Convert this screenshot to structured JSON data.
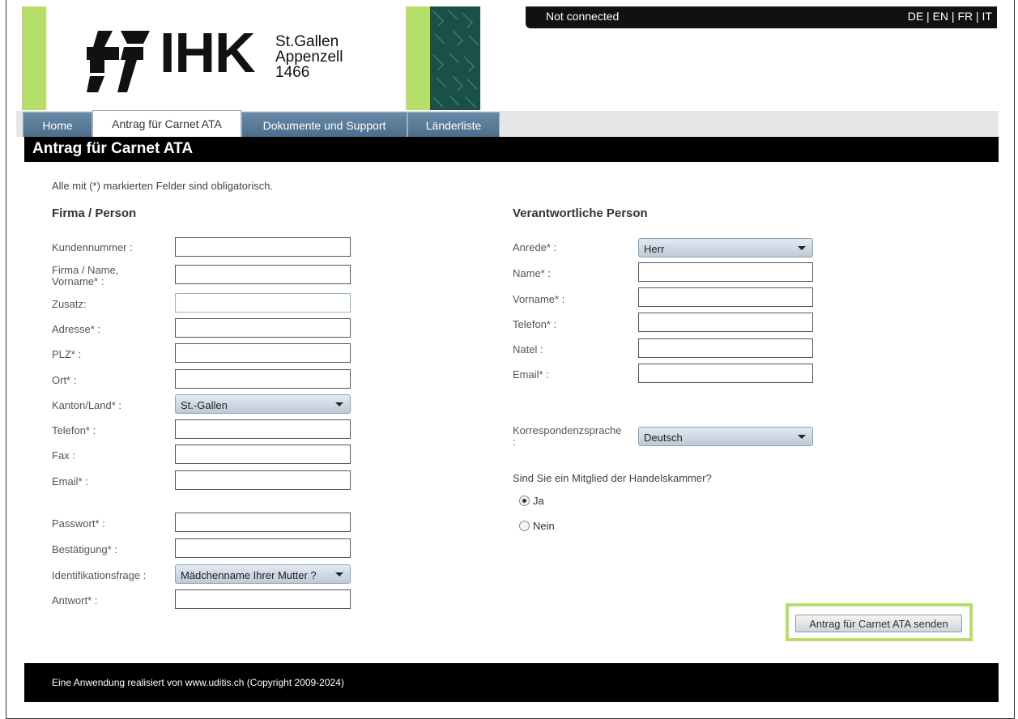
{
  "brand": {
    "name": "IHK",
    "sub_lines": [
      "St.Gallen",
      "Appenzell",
      "1466"
    ],
    "colors": {
      "green": "#b5de6a",
      "teal": "#1d4f49"
    }
  },
  "status": {
    "text": "Not connected"
  },
  "languages": [
    "DE",
    "EN",
    "FR",
    "IT"
  ],
  "nav": {
    "tabs": [
      {
        "label": "Home"
      },
      {
        "label": "Antrag für Carnet ATA",
        "active": true
      },
      {
        "label": "Dokumente und Support"
      },
      {
        "label": "Länderliste"
      }
    ]
  },
  "page_title": "Antrag für Carnet ATA",
  "note": "Alle mit (*) markierten Felder sind obligatorisch.",
  "company": {
    "title": "Firma / Person",
    "fields": {
      "kundennummer": {
        "label": "Kundennummer :",
        "value": ""
      },
      "firma": {
        "label_line1": "Firma / Name,",
        "label_line2": "Vorname* :",
        "value": ""
      },
      "zusatz": {
        "label": "Zusatz:",
        "value": ""
      },
      "adresse": {
        "label": "Adresse* :",
        "value": ""
      },
      "plz": {
        "label": "PLZ* :",
        "value": ""
      },
      "ort": {
        "label": "Ort* :",
        "value": ""
      },
      "kanton": {
        "label": "Kanton/Land* :",
        "value": "St.-Gallen"
      },
      "telefon": {
        "label": "Telefon* :",
        "value": ""
      },
      "fax": {
        "label": "Fax :",
        "value": ""
      },
      "email": {
        "label": "Email* :",
        "value": ""
      },
      "passwort": {
        "label": "Passwort* :",
        "value": ""
      },
      "bestaetigung": {
        "label": "Bestätigung* :",
        "value": ""
      },
      "identifikation": {
        "label": "Identifikationsfrage :",
        "value": "Mädchenname Ihrer Mutter ?"
      },
      "antwort": {
        "label": "Antwort* :",
        "value": ""
      }
    }
  },
  "person": {
    "title": "Verantwortliche Person",
    "fields": {
      "anrede": {
        "label": "Anrede* :",
        "value": "Herr"
      },
      "name": {
        "label": "Name* :",
        "value": ""
      },
      "vorname": {
        "label": "Vorname* :",
        "value": ""
      },
      "telefon": {
        "label": "Telefon* :",
        "value": ""
      },
      "natel": {
        "label": "Natel :",
        "value": ""
      },
      "email": {
        "label": "Email* :",
        "value": ""
      },
      "sprache": {
        "label_line1": "Korrespondenzsprache",
        "label_line2": ":",
        "value": "Deutsch"
      }
    },
    "member_question": "Sind Sie ein Mitglied der Handelskammer?",
    "member_options": [
      {
        "label": "Ja",
        "selected": true
      },
      {
        "label": "Nein",
        "selected": false
      }
    ]
  },
  "submit_label": "Antrag für Carnet ATA senden",
  "footer": "Eine Anwendung realisiert von www.uditis.ch (Copyright 2009-2024)"
}
